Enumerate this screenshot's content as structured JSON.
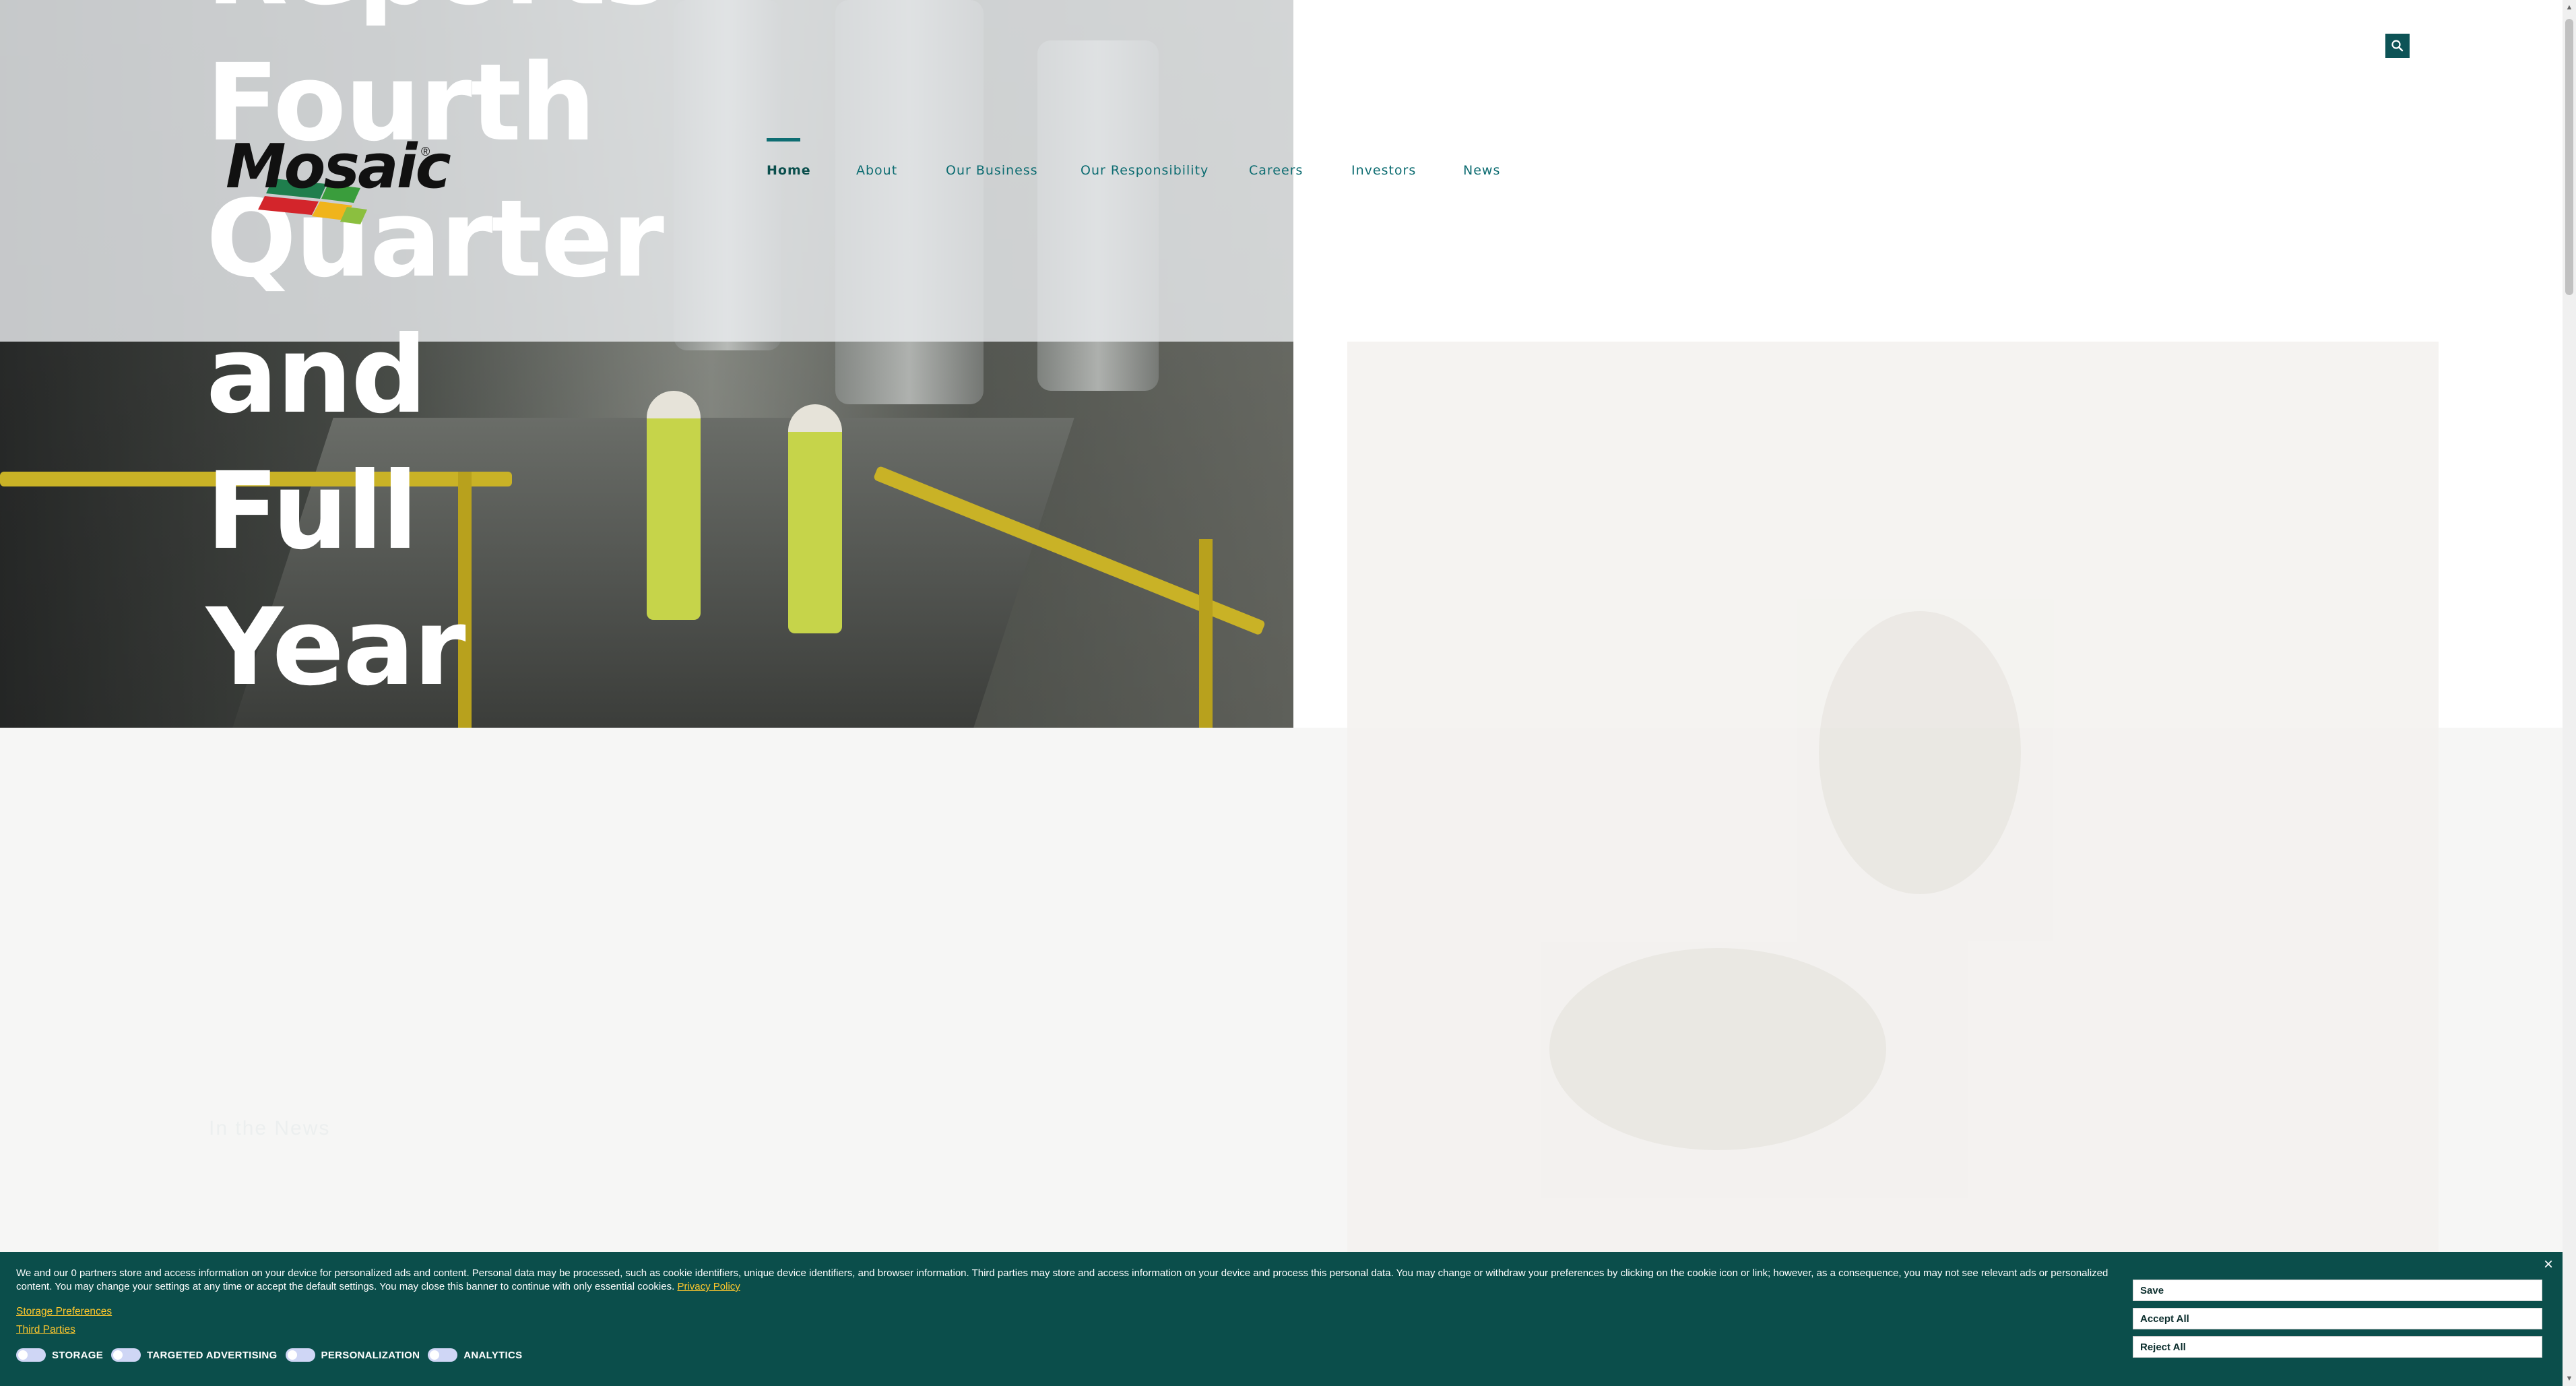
{
  "brand": {
    "logo_text": "Mosaic",
    "registered": "®"
  },
  "nav": {
    "items": [
      {
        "label": "Home",
        "active": true
      },
      {
        "label": "About"
      },
      {
        "label": "Our Business"
      },
      {
        "label": "Our Responsibility"
      },
      {
        "label": "Careers"
      },
      {
        "label": "Investors"
      },
      {
        "label": "News"
      }
    ]
  },
  "search": {
    "icon": "search-icon"
  },
  "hero": {
    "headline_lines": [
      "Reports",
      "Fourth",
      "Quarter",
      "and",
      "Full",
      "Year"
    ]
  },
  "lower": {
    "faint_text": "In the News"
  },
  "cookie_banner": {
    "text": "We and our 0 partners store and access information on your device for personalized ads and content. Personal data may be processed, such as cookie identifiers, unique device identifiers, and browser information. Third parties may store and access information on your device and process this personal data. You may change or withdraw your preferences by clicking on the cookie icon or link; however, as a consequence, you may not see relevant ads or personalized content. You may change your settings at any time or accept the default settings. You may close this banner to continue with only essential cookies.",
    "privacy_link": "Privacy Policy",
    "storage_prefs_link": "Storage Preferences",
    "third_parties_link": "Third Parties",
    "toggles": [
      {
        "label": "STORAGE"
      },
      {
        "label": "TARGETED ADVERTISING"
      },
      {
        "label": "PERSONALIZATION"
      },
      {
        "label": "ANALYTICS"
      }
    ],
    "buttons": {
      "save": "Save",
      "accept_all": "Accept All",
      "reject_all": "Reject All"
    },
    "close": "×"
  },
  "colors": {
    "brand_teal": "#0e6d72",
    "banner_bg": "#0b4e4b",
    "link_yellow": "#ffc72c"
  }
}
